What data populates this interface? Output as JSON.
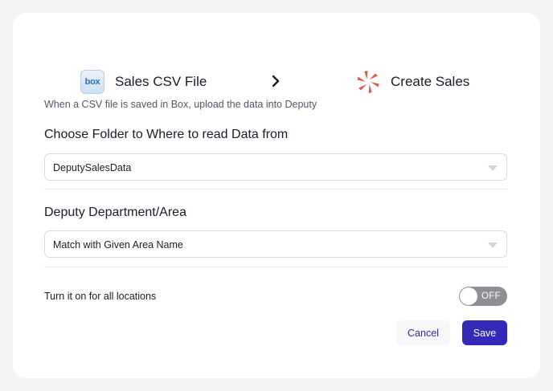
{
  "header": {
    "source_app": {
      "icon": "box-icon",
      "icon_text": "box",
      "title": "Sales CSV File"
    },
    "arrow_icon": "chevron-right-icon",
    "target_app": {
      "icon": "deputy-icon",
      "title": "Create Sales"
    }
  },
  "description": "When a CSV file is saved in Box, upload the data into Deputy",
  "folder_section": {
    "title": "Choose Folder to Where to read Data from",
    "selected_value": "DeputySalesData"
  },
  "area_section": {
    "title": "Deputy Department/Area",
    "selected_value": "Match with Given Area Name"
  },
  "locations_toggle": {
    "label": "Turn it on for all locations",
    "state_text": "OFF",
    "checked": false
  },
  "actions": {
    "cancel_label": "Cancel",
    "save_label": "Save"
  },
  "colors": {
    "primary": "#3428b8",
    "deputy_brand": "#e2574c",
    "toggle_off": "#8e8e93"
  }
}
